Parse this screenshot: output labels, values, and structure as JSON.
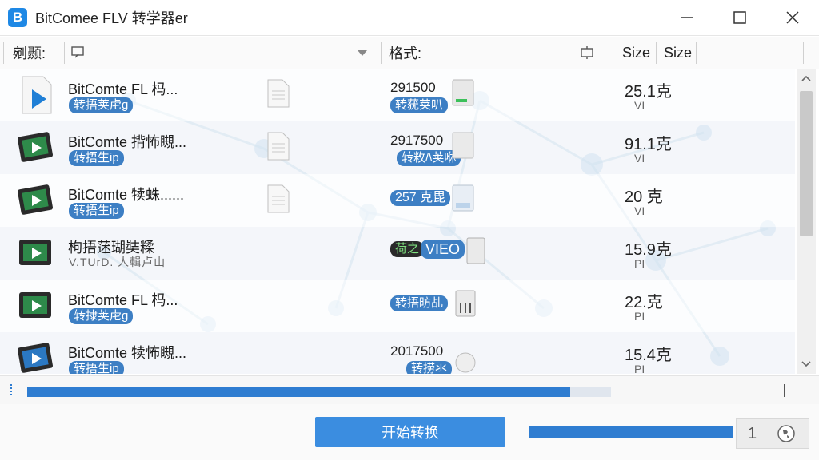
{
  "window": {
    "icon_letter": "B",
    "title": "BitComee FLV 转学​​​器er",
    "controls": [
      "minimize",
      "maximize",
      "close"
    ]
  },
  "header": {
    "col_title": "剜颞:",
    "col_format": "格式:",
    "col_size1": "Size",
    "col_size2": "Size"
  },
  "rows": [
    {
      "name": "BitComte FL 杩...",
      "tag": "转捂荚虍g",
      "num": "291500",
      "num_tag": "转莸荚叭",
      "size": "25.1克",
      "unit": "VI"
    },
    {
      "name": "BitComte 揹怖瞡...",
      "tag": "转捂生ip",
      "num": "2917500",
      "num_tag": "转敉/\\荚咻",
      "size": "91.1克",
      "unit": "VI"
    },
    {
      "name": "BitComte 犊蛛......",
      "tag": "转捂生ip",
      "num": "257 克毘",
      "num_tag": "",
      "size": "20 克",
      "unit": "VI"
    },
    {
      "name": "枸捂蒁瑚奘糅",
      "tag": "",
      "sub": "V.TUrD. 人輯卢山",
      "num": "荷之",
      "num_tag": "VIEO",
      "size": "15.9克",
      "unit": "PI"
    },
    {
      "name": "BitComte FL 杩...",
      "tag": "转捸荚虍g",
      "num": "转捂昉乩",
      "num_tag": "",
      "size": "22.克",
      "unit": "PI"
    },
    {
      "name": "BitComte 犊怖瞡...",
      "tag": "转捂生ip",
      "num": "2017500",
      "num_tag": "转捞氺",
      "size": "15.4克",
      "unit": "PI"
    }
  ],
  "progress": {
    "main": 0.93,
    "mini": 1.0
  },
  "buttons": {
    "start": "开始转换"
  },
  "pager": {
    "page": "1"
  },
  "colors": {
    "accent": "#3b8de0",
    "tag": "#3d7fc4"
  }
}
